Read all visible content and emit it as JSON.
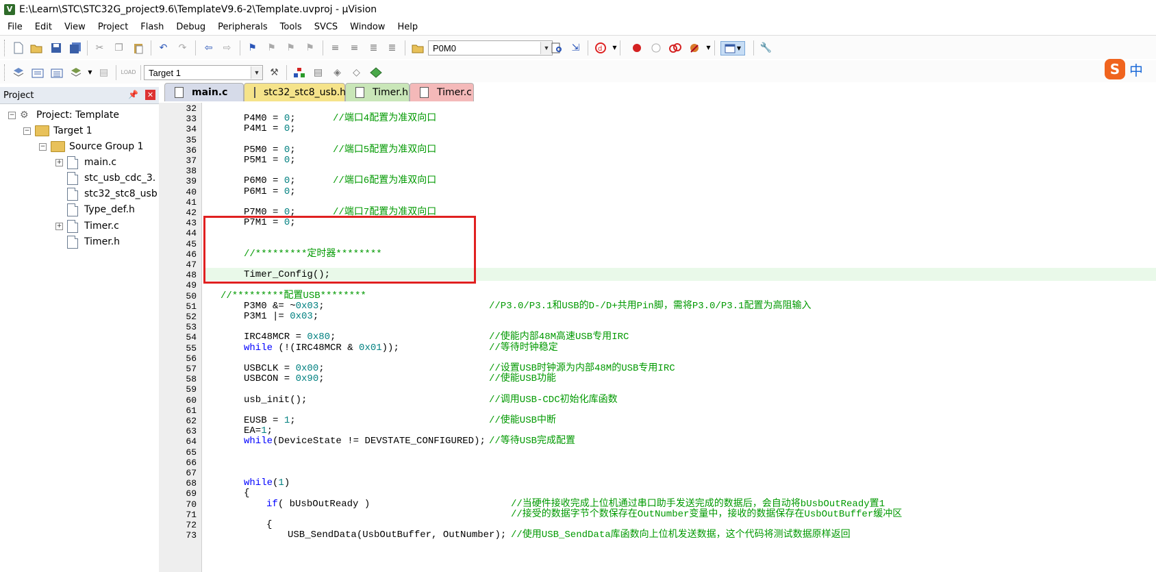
{
  "window": {
    "title": "E:\\Learn\\STC\\STC32G_project9.6\\TemplateV9.6-2\\Template.uvproj - µVision"
  },
  "menu": [
    "File",
    "Edit",
    "View",
    "Project",
    "Flash",
    "Debug",
    "Peripherals",
    "Tools",
    "SVCS",
    "Window",
    "Help"
  ],
  "toolbar": {
    "find_value": "P0M0",
    "target_value": "Target 1"
  },
  "ime": {
    "label": "中"
  },
  "project_panel": {
    "title": "Project",
    "tree": [
      {
        "label": "Project: Template",
        "level": 0,
        "expanded": true,
        "kind": "project"
      },
      {
        "label": "Target 1",
        "level": 1,
        "expanded": true,
        "kind": "target"
      },
      {
        "label": "Source Group 1",
        "level": 2,
        "expanded": true,
        "kind": "group"
      },
      {
        "label": "main.c",
        "level": 3,
        "expandable": true,
        "kind": "file"
      },
      {
        "label": "stc_usb_cdc_3.",
        "level": 3,
        "expandable": false,
        "kind": "file"
      },
      {
        "label": "stc32_stc8_usb",
        "level": 3,
        "expandable": false,
        "kind": "file"
      },
      {
        "label": "Type_def.h",
        "level": 3,
        "expandable": false,
        "kind": "file"
      },
      {
        "label": "Timer.c",
        "level": 3,
        "expandable": true,
        "kind": "file"
      },
      {
        "label": "Timer.h",
        "level": 3,
        "expandable": false,
        "kind": "file"
      }
    ]
  },
  "tabs": [
    {
      "label": "main.c",
      "active": true,
      "color": "#d6dbe9"
    },
    {
      "label": "stc32_stc8_usb.h",
      "active": false,
      "color": "#f5e38a"
    },
    {
      "label": "Timer.h",
      "active": false,
      "color": "#c9e6b8"
    },
    {
      "label": "Timer.c",
      "active": false,
      "color": "#f4b9b9"
    }
  ],
  "colors": {
    "comment": "#009900",
    "keyword": "#0000ff",
    "number": "#008080",
    "highlight_box": "#e02020"
  },
  "code_lines": [
    {
      "n": "32",
      "code": "",
      "comment": ""
    },
    {
      "n": "33",
      "code": "P4M0 = 0;",
      "comment": "//端口4配置为准双向口"
    },
    {
      "n": "34",
      "code": "P4M1 = 0;",
      "comment": ""
    },
    {
      "n": "35",
      "code": "",
      "comment": ""
    },
    {
      "n": "36",
      "code": "P5M0 = 0;",
      "comment": "//端口5配置为准双向口"
    },
    {
      "n": "37",
      "code": "P5M1 = 0;",
      "comment": ""
    },
    {
      "n": "38",
      "code": "",
      "comment": ""
    },
    {
      "n": "39",
      "code": "P6M0 = 0;",
      "comment": "//端口6配置为准双向口"
    },
    {
      "n": "40",
      "code": "P6M1 = 0;",
      "comment": ""
    },
    {
      "n": "41",
      "code": "",
      "comment": ""
    },
    {
      "n": "42",
      "code": "P7M0 = 0;",
      "comment": "//端口7配置为准双向口"
    },
    {
      "n": "43",
      "code": "P7M1 = 0;",
      "comment": ""
    },
    {
      "n": "44",
      "code": "",
      "comment": ""
    },
    {
      "n": "45",
      "code": "",
      "comment": ""
    },
    {
      "n": "46",
      "code": "",
      "comment": "//*********定时器********"
    },
    {
      "n": "47",
      "code": "",
      "comment": ""
    },
    {
      "n": "48",
      "code": "Timer_Config();",
      "comment": ""
    },
    {
      "n": "49",
      "code": "",
      "comment": ""
    },
    {
      "n": "50",
      "code": "",
      "comment": "//*********配置USB********"
    },
    {
      "n": "51",
      "code": "P3M0 &= ~0x03;",
      "comment": "//P3.0/P3.1和USB的D-/D+共用Pin脚，需将P3.0/P3.1配置为高阻输入"
    },
    {
      "n": "52",
      "code": "P3M1 |= 0x03;",
      "comment": ""
    },
    {
      "n": "53",
      "code": "",
      "comment": ""
    },
    {
      "n": "54",
      "code": "IRC48MCR = 0x80;",
      "comment": "//使能内部48M高速USB专用IRC"
    },
    {
      "n": "55",
      "code": "while (!(IRC48MCR & 0x01));",
      "comment": "//等待时钟稳定"
    },
    {
      "n": "56",
      "code": "",
      "comment": ""
    },
    {
      "n": "57",
      "code": "USBCLK = 0x00;",
      "comment": "//设置USB时钟源为内部48M的USB专用IRC"
    },
    {
      "n": "58",
      "code": "USBCON = 0x90;",
      "comment": "//使能USB功能"
    },
    {
      "n": "59",
      "code": "",
      "comment": ""
    },
    {
      "n": "60",
      "code": "usb_init();",
      "comment": "//调用USB-CDC初始化库函数"
    },
    {
      "n": "61",
      "code": "",
      "comment": ""
    },
    {
      "n": "62",
      "code": "EUSB = 1;",
      "comment": "//使能USB中断"
    },
    {
      "n": "63",
      "code": "EA=1;",
      "comment": ""
    },
    {
      "n": "64",
      "code": "while(DeviceState != DEVSTATE_CONFIGURED);",
      "comment": "//等待USB完成配置"
    },
    {
      "n": "65",
      "code": "",
      "comment": ""
    },
    {
      "n": "66",
      "code": "",
      "comment": ""
    },
    {
      "n": "67",
      "code": "",
      "comment": ""
    },
    {
      "n": "68",
      "code": "while(1)",
      "comment": ""
    },
    {
      "n": "69",
      "code": "{",
      "comment": ""
    },
    {
      "n": "70",
      "code": "if( bUsbOutReady )",
      "comment": "//当硬件接收完成上位机通过串口助手发送完成的数据后，会自动将bUsbOutReady置1"
    },
    {
      "n": "71",
      "code": "",
      "comment": "//接受的数据字节个数保存在OutNumber变量中，接收的数据保存在UsbOutBuffer缓冲区"
    },
    {
      "n": "72",
      "code": "{",
      "comment": ""
    },
    {
      "n": "73",
      "code": "USB_SendData(UsbOutBuffer, OutNumber);",
      "comment": "//使用USB_SendData库函数向上位机发送数据，这个代码将测试数据原样返回"
    }
  ]
}
